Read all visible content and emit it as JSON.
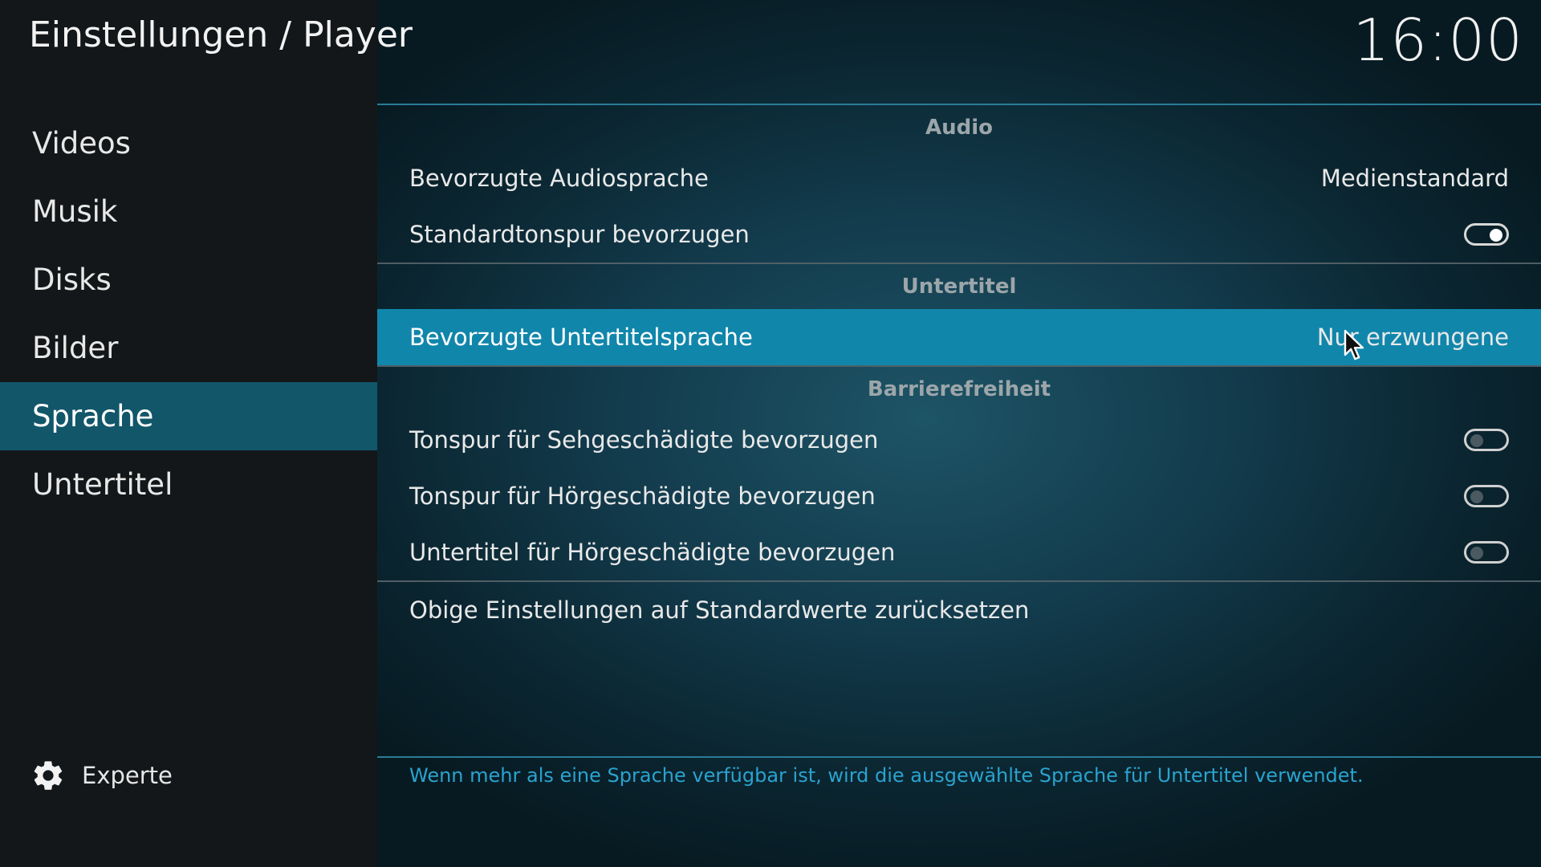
{
  "header": {
    "title": "Einstellungen / Player",
    "clock": "16:00"
  },
  "sidebar": {
    "items": [
      {
        "label": "Videos",
        "active": false
      },
      {
        "label": "Musik",
        "active": false
      },
      {
        "label": "Disks",
        "active": false
      },
      {
        "label": "Bilder",
        "active": false
      },
      {
        "label": "Sprache",
        "active": true
      },
      {
        "label": "Untertitel",
        "active": false
      }
    ],
    "level_label": "Experte",
    "level_icon": "gear-icon"
  },
  "sections": {
    "audio": {
      "title": "Audio",
      "preferred_language": {
        "label": "Bevorzugte Audiosprache",
        "value": "Medienstandard"
      },
      "prefer_default_track": {
        "label": "Standardtonspur bevorzugen",
        "enabled": true
      }
    },
    "subtitles": {
      "title": "Untertitel",
      "preferred_language": {
        "label": "Bevorzugte Untertitelsprache",
        "value": "Nur erzwungene"
      }
    },
    "accessibility": {
      "title": "Barrierefreiheit",
      "visually_impaired": {
        "label": "Tonspur für Sehgeschädigte bevorzugen",
        "enabled": false
      },
      "hearing_impaired_audio": {
        "label": "Tonspur für Hörgeschädigte bevorzugen",
        "enabled": false
      },
      "hearing_impaired_subs": {
        "label": "Untertitel für Hörgeschädigte bevorzugen",
        "enabled": false
      }
    },
    "reset_label": "Obige Einstellungen auf Standardwerte zurücksetzen"
  },
  "help_text": "Wenn mehr als eine Sprache verfügbar ist, wird die ausgewählte Sprache für Untertitel verwendet.",
  "colors": {
    "accent": "#1186ab",
    "help_text": "#2aa3cf",
    "sidebar_bg": "#131719",
    "active_item": "#12566a"
  }
}
